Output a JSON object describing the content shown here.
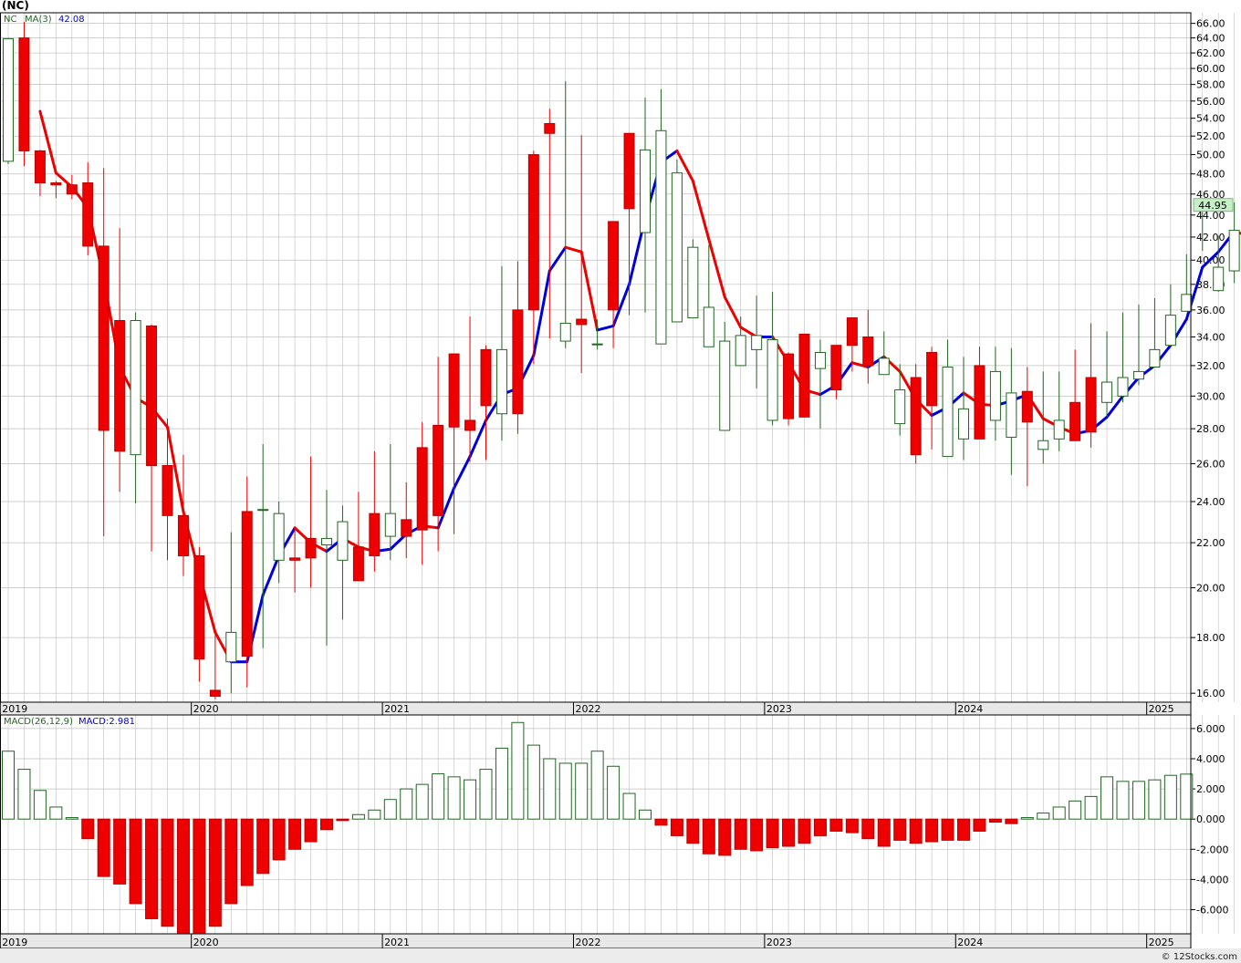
{
  "page": {
    "title": "(NC)",
    "credit": "© 12Stocks.com"
  },
  "price_panel": {
    "symbol": "NC",
    "ma_label": "MA(3)",
    "ma_value": "42.08",
    "last_price": "44.95",
    "y_ticks": [
      "66.00",
      "64.00",
      "62.00",
      "60.00",
      "58.00",
      "56.00",
      "54.00",
      "52.00",
      "50.00",
      "48.00",
      "46.00",
      "44.00",
      "42.00",
      "40.00",
      "38.00",
      "36.00",
      "34.00",
      "32.00",
      "30.00",
      "28.00",
      "26.00",
      "24.00",
      "22.00",
      "20.00",
      "18.00",
      "16.00"
    ],
    "year_labels": [
      "2019",
      "2020",
      "2021",
      "2022",
      "2023",
      "2024",
      "2025"
    ]
  },
  "macd_panel": {
    "label": "MACD(26,12,9)",
    "value_label": "MACD:2.981",
    "y_ticks": [
      "6.000",
      "4.000",
      "2.000",
      "0.000",
      "-2.000",
      "-4.000",
      "-6.000"
    ],
    "year_labels": [
      "2019",
      "2020",
      "2021",
      "2022",
      "2023",
      "2024",
      "2025"
    ]
  },
  "colors": {
    "up": "#226622",
    "down": "#ee0000",
    "ma_up": "#0000dd",
    "ma_down": "#ee0000",
    "grid": "#bfbfbf",
    "axis_bg": "#e8e8e8",
    "last_price_bg": "#c8f0c8"
  },
  "chart_data": [
    {
      "type": "candlestick",
      "scale": "log",
      "ylim": [
        15.7,
        67.5
      ],
      "months": [
        "2019-01",
        "2019-02",
        "2019-03",
        "2019-04",
        "2019-05",
        "2019-06",
        "2019-07",
        "2019-08",
        "2019-09",
        "2019-10",
        "2019-11",
        "2019-12",
        "2020-01",
        "2020-02",
        "2020-03",
        "2020-04",
        "2020-05",
        "2020-06",
        "2020-07",
        "2020-08",
        "2020-09",
        "2020-10",
        "2020-11",
        "2020-12",
        "2021-01",
        "2021-02",
        "2021-03",
        "2021-04",
        "2021-05",
        "2021-06",
        "2021-07",
        "2021-08",
        "2021-09",
        "2021-10",
        "2021-11",
        "2021-12",
        "2022-01",
        "2022-02",
        "2022-03",
        "2022-04",
        "2022-05",
        "2022-06",
        "2022-07",
        "2022-08",
        "2022-09",
        "2022-10",
        "2022-11",
        "2022-12",
        "2023-01",
        "2023-02",
        "2023-03",
        "2023-04",
        "2023-05",
        "2023-06",
        "2023-07",
        "2023-08",
        "2023-09",
        "2023-10",
        "2023-11",
        "2023-12",
        "2024-01",
        "2024-02",
        "2024-03",
        "2024-04",
        "2024-05",
        "2024-06",
        "2024-07",
        "2024-08",
        "2024-09",
        "2024-10",
        "2024-11",
        "2024-12",
        "2025-01",
        "2025-02",
        "2025-03",
        "2025-04",
        "2025-05",
        "2025-06",
        "2025-07",
        "2025-08",
        "2025-09"
      ],
      "open": [
        49.3,
        64.0,
        50.4,
        47.1,
        46.9,
        47.1,
        41.2,
        35.2,
        26.5,
        34.8,
        25.9,
        23.3,
        21.4,
        16.1,
        17.1,
        23.5,
        23.6,
        21.2,
        21.3,
        22.2,
        21.9,
        21.2,
        21.8,
        23.4,
        22.3,
        23.1,
        26.9,
        28.2,
        32.8,
        28.5,
        33.1,
        28.9,
        36.0,
        50.0,
        53.4,
        33.7,
        35.3,
        33.5,
        43.4,
        52.3,
        42.4,
        33.5,
        35.1,
        35.4,
        33.3,
        27.9,
        32.0,
        33.1,
        28.5,
        32.8,
        34.2,
        31.8,
        33.4,
        35.4,
        34.0,
        31.4,
        28.3,
        31.2,
        32.9,
        26.4,
        27.4,
        32.0,
        28.5,
        27.5,
        30.3,
        26.8,
        27.4,
        29.6,
        31.2,
        29.6,
        30.0,
        31.1,
        31.9,
        33.4,
        35.9,
        44.6,
        37.5,
        39.1,
        42.2
      ],
      "close": [
        63.9,
        50.4,
        47.1,
        46.9,
        46.0,
        41.2,
        27.9,
        26.7,
        35.2,
        25.9,
        23.3,
        21.4,
        17.2,
        15.9,
        18.2,
        17.3,
        23.6,
        23.4,
        21.2,
        21.3,
        22.2,
        23.0,
        20.3,
        21.4,
        23.4,
        22.3,
        22.6,
        23.3,
        28.1,
        27.9,
        29.4,
        33.1,
        28.9,
        36.0,
        52.3,
        35.0,
        34.9,
        33.5,
        36.0,
        44.6,
        50.5,
        52.6,
        48.1,
        41.1,
        36.2,
        33.7,
        34.1,
        34.1,
        33.8,
        28.6,
        28.7,
        32.9,
        30.4,
        33.4,
        32.0,
        32.5,
        30.4,
        26.5,
        29.4,
        31.9,
        29.2,
        27.4,
        31.6,
        30.2,
        28.4,
        27.3,
        28.5,
        27.3,
        27.8,
        30.9,
        31.2,
        31.6,
        33.1,
        35.6,
        37.2,
        45.5,
        39.4,
        42.6,
        44.95
      ],
      "high": [
        64.0,
        66.2,
        50.5,
        47.3,
        47.9,
        49.2,
        48.6,
        42.8,
        35.8,
        34.9,
        28.6,
        26.5,
        21.8,
        18.3,
        22.5,
        25.3,
        27.1,
        24.0,
        22.7,
        26.4,
        24.6,
        23.8,
        24.5,
        26.7,
        27.1,
        25.0,
        28.4,
        32.6,
        31.3,
        35.5,
        33.4,
        39.5,
        39.9,
        50.4,
        55.1,
        58.4,
        52.1,
        35.3,
        39.0,
        51.0,
        56.4,
        57.4,
        49.5,
        41.8,
        41.3,
        35.1,
        35.5,
        37.1,
        37.4,
        32.9,
        33.4,
        33.8,
        32.2,
        35.1,
        36.0,
        34.4,
        32.1,
        32.1,
        33.3,
        33.8,
        32.6,
        33.3,
        33.3,
        33.2,
        31.9,
        31.6,
        31.6,
        33.1,
        35.0,
        34.4,
        35.8,
        36.4,
        36.9,
        38.0,
        40.5,
        44.3,
        42.1,
        45.2,
        44.9
      ],
      "low": [
        49.0,
        48.8,
        45.8,
        45.6,
        45.5,
        40.4,
        22.3,
        24.5,
        23.9,
        21.6,
        21.2,
        20.5,
        16.4,
        15.8,
        16.0,
        16.2,
        17.6,
        20.2,
        19.8,
        20.0,
        17.7,
        18.7,
        20.6,
        20.7,
        21.2,
        21.3,
        21.0,
        21.6,
        22.4,
        26.1,
        26.2,
        27.3,
        27.7,
        32.1,
        33.9,
        33.2,
        31.5,
        33.1,
        33.2,
        35.6,
        35.8,
        34.4,
        37.3,
        40.7,
        33.6,
        32.5,
        32.0,
        30.5,
        28.2,
        28.2,
        29.9,
        28.0,
        29.8,
        31.6,
        30.8,
        31.5,
        27.6,
        26.0,
        26.8,
        26.6,
        26.2,
        27.4,
        27.3,
        25.4,
        24.8,
        26.0,
        26.7,
        28.9,
        26.9,
        28.7,
        29.6,
        30.7,
        32.2,
        34.1,
        36.1,
        40.8,
        37.4,
        38.1,
        39.8
      ],
      "ma3": [
        null,
        null,
        54.8,
        48.1,
        46.7,
        44.7,
        38.4,
        31.9,
        29.9,
        29.3,
        28.1,
        23.5,
        20.6,
        18.2,
        17.1,
        17.1,
        19.7,
        21.4,
        22.7,
        22.0,
        21.6,
        22.2,
        21.8,
        21.6,
        21.7,
        22.4,
        22.8,
        22.7,
        24.7,
        26.4,
        28.5,
        30.1,
        30.5,
        32.7,
        39.1,
        41.1,
        40.7,
        34.5,
        34.8,
        38.0,
        43.7,
        49.2,
        50.4,
        47.3,
        41.8,
        37.0,
        34.7,
        34.0,
        34.0,
        32.2,
        30.4,
        30.1,
        30.7,
        32.2,
        31.9,
        32.6,
        31.6,
        29.8,
        28.8,
        29.3,
        30.2,
        29.5,
        29.4,
        29.7,
        30.1,
        28.6,
        28.1,
        27.7,
        27.9,
        28.7,
        30.0,
        31.2,
        32.0,
        33.4,
        35.3,
        39.4,
        40.7,
        42.5,
        42.08
      ]
    },
    {
      "type": "bar",
      "ylim": [
        -7.6,
        6.9
      ],
      "months": [
        "2019-01",
        "2019-02",
        "2019-03",
        "2019-04",
        "2019-05",
        "2019-06",
        "2019-07",
        "2019-08",
        "2019-09",
        "2019-10",
        "2019-11",
        "2019-12",
        "2020-01",
        "2020-02",
        "2020-03",
        "2020-04",
        "2020-05",
        "2020-06",
        "2020-07",
        "2020-08",
        "2020-09",
        "2020-10",
        "2020-11",
        "2020-12",
        "2021-01",
        "2021-02",
        "2021-03",
        "2021-04",
        "2021-05",
        "2021-06",
        "2021-07",
        "2021-08",
        "2021-09",
        "2021-10",
        "2021-11",
        "2021-12",
        "2022-01",
        "2022-02",
        "2022-03",
        "2022-04",
        "2022-05",
        "2022-06",
        "2022-07",
        "2022-08",
        "2022-09",
        "2022-10",
        "2022-11",
        "2022-12",
        "2023-01",
        "2023-02",
        "2023-03",
        "2023-04",
        "2023-05",
        "2023-06",
        "2023-07",
        "2023-08",
        "2023-09",
        "2023-10",
        "2023-11",
        "2023-12",
        "2024-01",
        "2024-02",
        "2024-03",
        "2024-04",
        "2024-05",
        "2024-06",
        "2024-07",
        "2024-08",
        "2024-09",
        "2024-10",
        "2024-11",
        "2024-12",
        "2025-01",
        "2025-02",
        "2025-03",
        "2025-04",
        "2025-05",
        "2025-06",
        "2025-07",
        "2025-08",
        "2025-09"
      ],
      "values": [
        4.5,
        3.3,
        1.9,
        0.8,
        0.1,
        -1.3,
        -3.8,
        -4.3,
        -5.6,
        -6.6,
        -7.1,
        -7.6,
        -7.6,
        -7.1,
        -5.6,
        -4.4,
        -3.6,
        -2.7,
        -2.0,
        -1.5,
        -0.7,
        -0.1,
        0.3,
        0.6,
        1.3,
        2.0,
        2.3,
        3.0,
        2.8,
        2.6,
        3.3,
        4.7,
        6.4,
        4.9,
        4.0,
        3.7,
        3.7,
        4.5,
        3.5,
        1.7,
        0.6,
        -0.4,
        -1.1,
        -1.6,
        -2.3,
        -2.4,
        -2.0,
        -2.1,
        -1.9,
        -1.8,
        -1.6,
        -1.1,
        -0.8,
        -0.9,
        -1.3,
        -1.8,
        -1.4,
        -1.6,
        -1.5,
        -1.4,
        -1.4,
        -0.8,
        -0.2,
        -0.3,
        0.1,
        0.4,
        0.8,
        1.2,
        1.5,
        2.8,
        2.5,
        2.5,
        2.6,
        2.9,
        2.981
      ]
    }
  ]
}
